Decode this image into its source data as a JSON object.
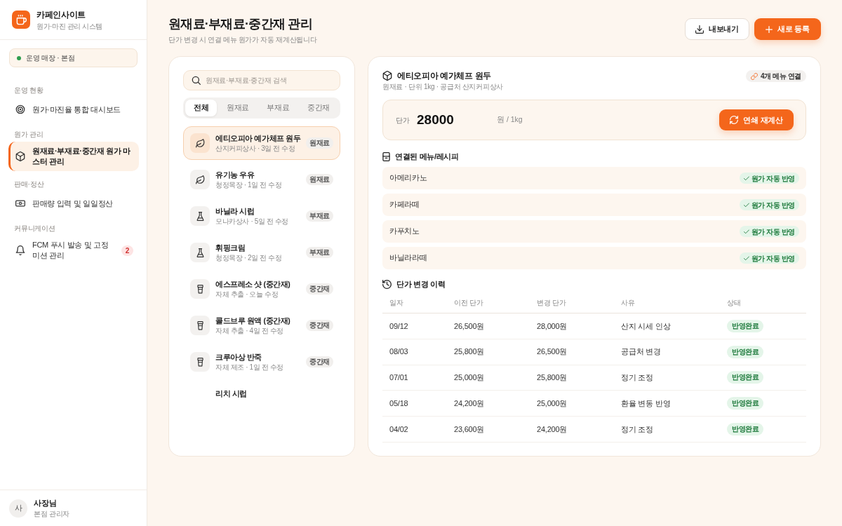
{
  "sidebar": {
    "brand": {
      "name": "카페인사이트",
      "tagline": "원가·마진 관리 시스템"
    },
    "store": "운영 매장 · 본점",
    "sections": [
      {
        "label": "운영 현황",
        "items": [
          {
            "label": "원가·마진율 통합 대시보드",
            "selected": false
          }
        ]
      },
      {
        "label": "원가 관리",
        "items": [
          {
            "label": "원재료·부재료·중간재 원가 마스터 관리",
            "selected": true
          }
        ]
      },
      {
        "label": "판매·정산",
        "items": [
          {
            "label": "판매량 입력 및 일일정산",
            "selected": false
          }
        ]
      },
      {
        "label": "커뮤니케이션",
        "items": [
          {
            "label": "FCM 푸시 발송 및 고정 미션 관리",
            "selected": false,
            "badge": "2"
          }
        ]
      }
    ],
    "user": {
      "initial": "사",
      "name": "사장님",
      "role": "본점 관리자"
    }
  },
  "header": {
    "title": "원재료·부재료·중간재 관리",
    "subtitle": "단가 변경 시 연결 메뉴 원가가 자동 재계산됩니다",
    "buttons": [
      {
        "label": "내보내기",
        "kind": "secondary"
      },
      {
        "label": "새로 등록",
        "kind": "primary"
      }
    ]
  },
  "materials": {
    "search": {
      "placeholder": "원재료·부재료·중간재 검색"
    },
    "tabs": [
      {
        "label": "전체",
        "selected": true
      },
      {
        "label": "원재료",
        "selected": false
      },
      {
        "label": "부재료",
        "selected": false
      },
      {
        "label": "중간재",
        "selected": false
      }
    ],
    "items": [
      {
        "name": "에티오피아 예가체프 원두",
        "meta": "산지커피상사 · 3일 전 수정",
        "tag": "원재료",
        "kind": "raw",
        "selected": true
      },
      {
        "name": "유기농 우유",
        "meta": "청정목장 · 1일 전 수정",
        "tag": "원재료",
        "kind": "raw",
        "selected": false
      },
      {
        "name": "바닐라 시럽",
        "meta": "모나카상사 · 5일 전 수정",
        "tag": "부재료",
        "kind": "sub",
        "selected": false
      },
      {
        "name": "휘핑크림",
        "meta": "청정목장 · 2일 전 수정",
        "tag": "부재료",
        "kind": "sub",
        "selected": false
      },
      {
        "name": "에스프레소 샷 (중간재)",
        "meta": "자체 추출 · 오늘 수정",
        "tag": "중간재",
        "kind": "mid",
        "selected": false
      },
      {
        "name": "콜드브루 원액 (중간재)",
        "meta": "자체 추출 · 4일 전 수정",
        "tag": "중간재",
        "kind": "mid",
        "selected": false
      },
      {
        "name": "크루아상 반죽",
        "meta": "자체 제조 · 1일 전 수정",
        "tag": "중간재",
        "kind": "mid",
        "selected": false
      },
      {
        "name": "리치 시럽",
        "selected": false
      }
    ]
  },
  "detail": {
    "title": "에티오피아 예가체프 원두",
    "subtitle": "원재료 · 단위 1kg · 공급처 산지커피상사",
    "links_badge": "4개 메뉴 연결",
    "price": {
      "label": "단가",
      "value": "28000",
      "unit": "원 / 1kg",
      "button": "연쇄 재계산"
    },
    "menus": {
      "title": "연결된 메뉴/레시피",
      "rows": [
        {
          "name": "아메리카노",
          "status": "원가 자동 반영"
        },
        {
          "name": "카페라떼",
          "status": "원가 자동 반영"
        },
        {
          "name": "카푸치노",
          "status": "원가 자동 반영"
        },
        {
          "name": "바닐라라떼",
          "status": "원가 자동 반영"
        }
      ]
    },
    "history": {
      "title": "단가 변경 이력",
      "columns": [
        "일자",
        "이전 단가",
        "변경 단가",
        "사유",
        "상태"
      ],
      "rows": [
        {
          "date": "09/12",
          "previous": "26,500원",
          "changed": "28,000원",
          "reason": "산지 시세 인상",
          "status": "반영완료"
        },
        {
          "date": "08/03",
          "previous": "25,800원",
          "changed": "26,500원",
          "reason": "공급처 변경",
          "status": "반영완료"
        },
        {
          "date": "07/01",
          "previous": "25,000원",
          "changed": "25,800원",
          "reason": "정기 조정",
          "status": "반영완료"
        },
        {
          "date": "05/18",
          "previous": "24,200원",
          "changed": "25,000원",
          "reason": "환율 변동 반영",
          "status": "반영완료"
        },
        {
          "date": "04/02",
          "previous": "23,600원",
          "changed": "24,200원",
          "reason": "정기 조정",
          "status": "반영완료"
        }
      ]
    }
  }
}
